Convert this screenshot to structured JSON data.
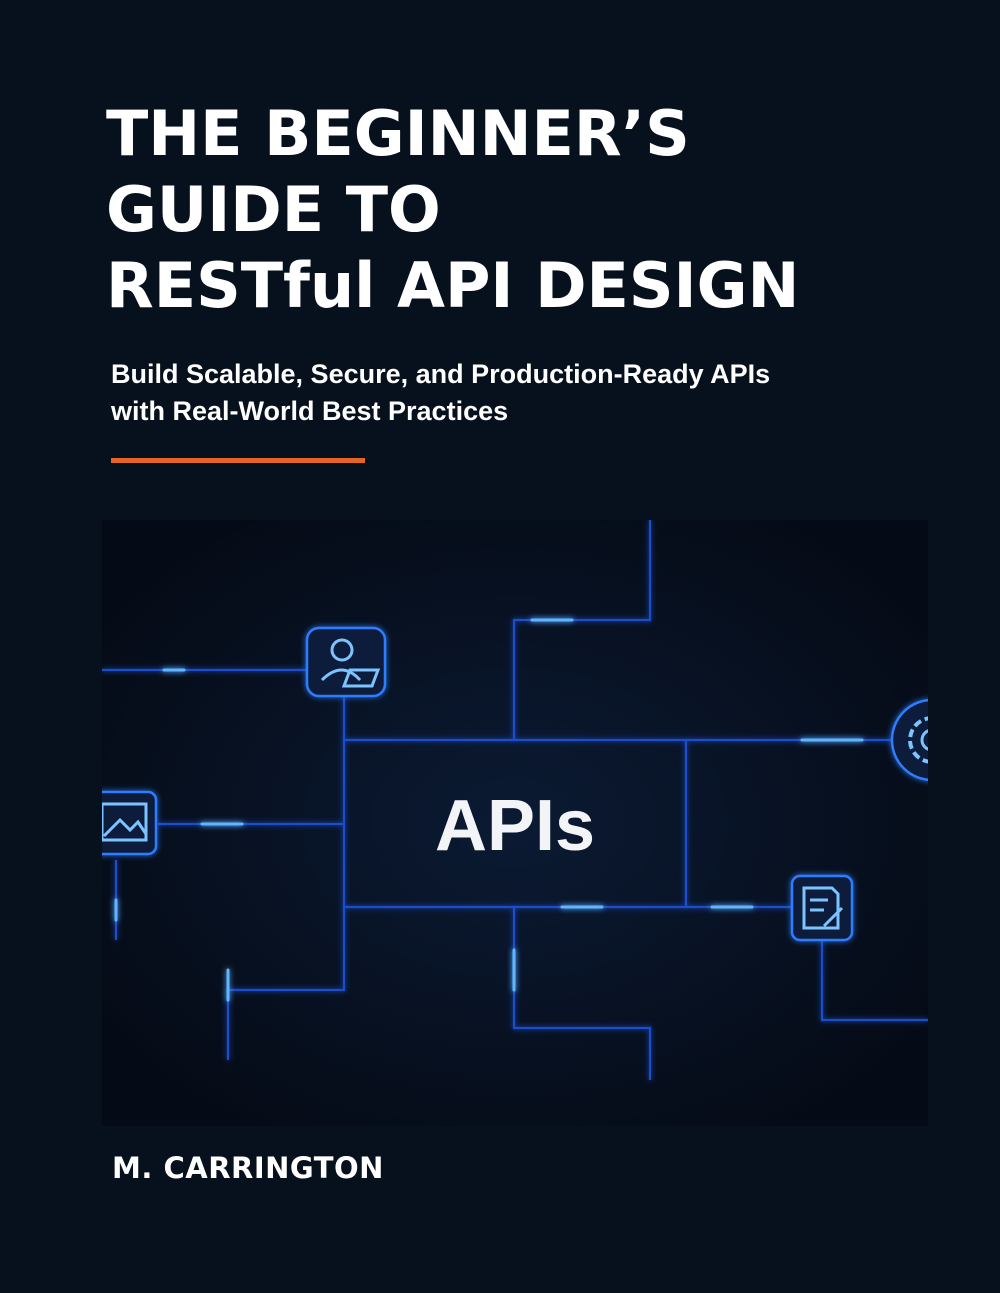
{
  "cover": {
    "title_lines": [
      "THE BEGINNER’S",
      "GUIDE TO",
      "RESTful  API DESIGN"
    ],
    "subtitle_lines": [
      "Build Scalable, Secure, and Production-Ready APIs",
      "with Real-World Best Practices"
    ],
    "center_label": "APIs",
    "author": "M. CARRINGTON"
  },
  "colors": {
    "background": "#07101d",
    "accent": "#e8651f",
    "circuit_glow": "#1e6bff",
    "text": "#ffffff"
  },
  "icons": [
    "user-laptop-icon",
    "image-icon",
    "gear-icon",
    "document-edit-icon"
  ]
}
